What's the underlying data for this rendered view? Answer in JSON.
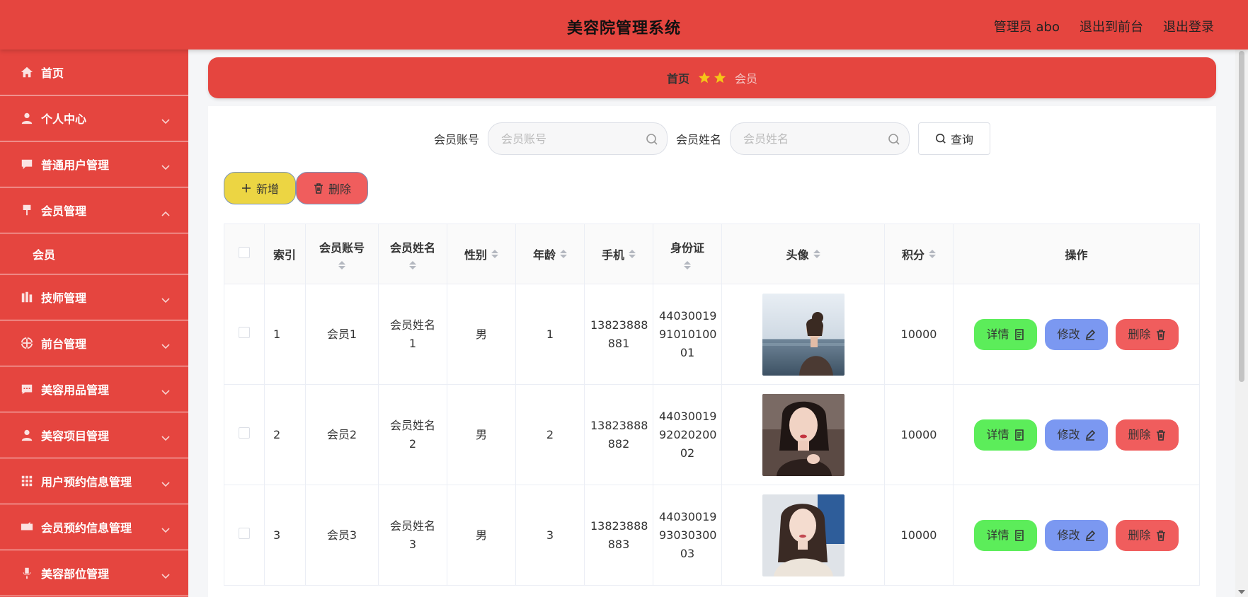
{
  "header": {
    "title": "美容院管理系统",
    "admin_label": "管理员 abo",
    "to_front_label": "退出到前台",
    "logout_label": "退出登录"
  },
  "sidebar": {
    "items": [
      {
        "label": "首页",
        "icon": "home-icon"
      },
      {
        "label": "个人中心",
        "icon": "user-icon"
      },
      {
        "label": "普通用户管理",
        "icon": "chat-icon"
      },
      {
        "label": "会员管理",
        "icon": "pin-icon"
      },
      {
        "label": "会员",
        "icon": ""
      },
      {
        "label": "技师管理",
        "icon": "building-icon"
      },
      {
        "label": "前台管理",
        "icon": "globe-icon"
      },
      {
        "label": "美容用品管理",
        "icon": "message-icon"
      },
      {
        "label": "美容项目管理",
        "icon": "user-icon"
      },
      {
        "label": "用户预约信息管理",
        "icon": "grid-icon"
      },
      {
        "label": "会员预约信息管理",
        "icon": "ticket-icon"
      },
      {
        "label": "美容部位管理",
        "icon": "mic-icon"
      }
    ]
  },
  "breadcrumb": {
    "home": "首页",
    "current": "会员"
  },
  "search": {
    "account_label": "会员账号",
    "account_placeholder": "会员账号",
    "name_label": "会员姓名",
    "name_placeholder": "会员姓名",
    "query_label": "查询"
  },
  "actions": {
    "add_label": "新增",
    "delete_label": "删除"
  },
  "table": {
    "columns": [
      "索引",
      "会员账号",
      "会员姓名",
      "性别",
      "年龄",
      "手机",
      "身份证",
      "头像",
      "积分",
      "操作"
    ],
    "rows": [
      {
        "index": "1",
        "account": "会员1",
        "name_line1": "会员姓名",
        "name_line2": "1",
        "gender": "男",
        "age": "1",
        "phone_line1": "13823888",
        "phone_line2": "881",
        "id_line1": "44030019",
        "id_line2": "91010100",
        "id_line3": "01",
        "points": "10000"
      },
      {
        "index": "2",
        "account": "会员2",
        "name_line1": "会员姓名",
        "name_line2": "2",
        "gender": "男",
        "age": "2",
        "phone_line1": "13823888",
        "phone_line2": "882",
        "id_line1": "44030019",
        "id_line2": "92020200",
        "id_line3": "02",
        "points": "10000"
      },
      {
        "index": "3",
        "account": "会员3",
        "name_line1": "会员姓名",
        "name_line2": "3",
        "gender": "男",
        "age": "3",
        "phone_line1": "13823888",
        "phone_line2": "883",
        "id_line1": "44030019",
        "id_line2": "93030300",
        "id_line3": "03",
        "points": "10000"
      }
    ],
    "op_detail": "详情",
    "op_edit": "修改",
    "op_delete": "删除"
  },
  "colors": {
    "primary": "#e5453f",
    "add_button": "#ecd543",
    "delete_button": "#f05d5d",
    "detail_button": "#5ced5a",
    "edit_button": "#7b98f1",
    "star": "#f5c518"
  }
}
